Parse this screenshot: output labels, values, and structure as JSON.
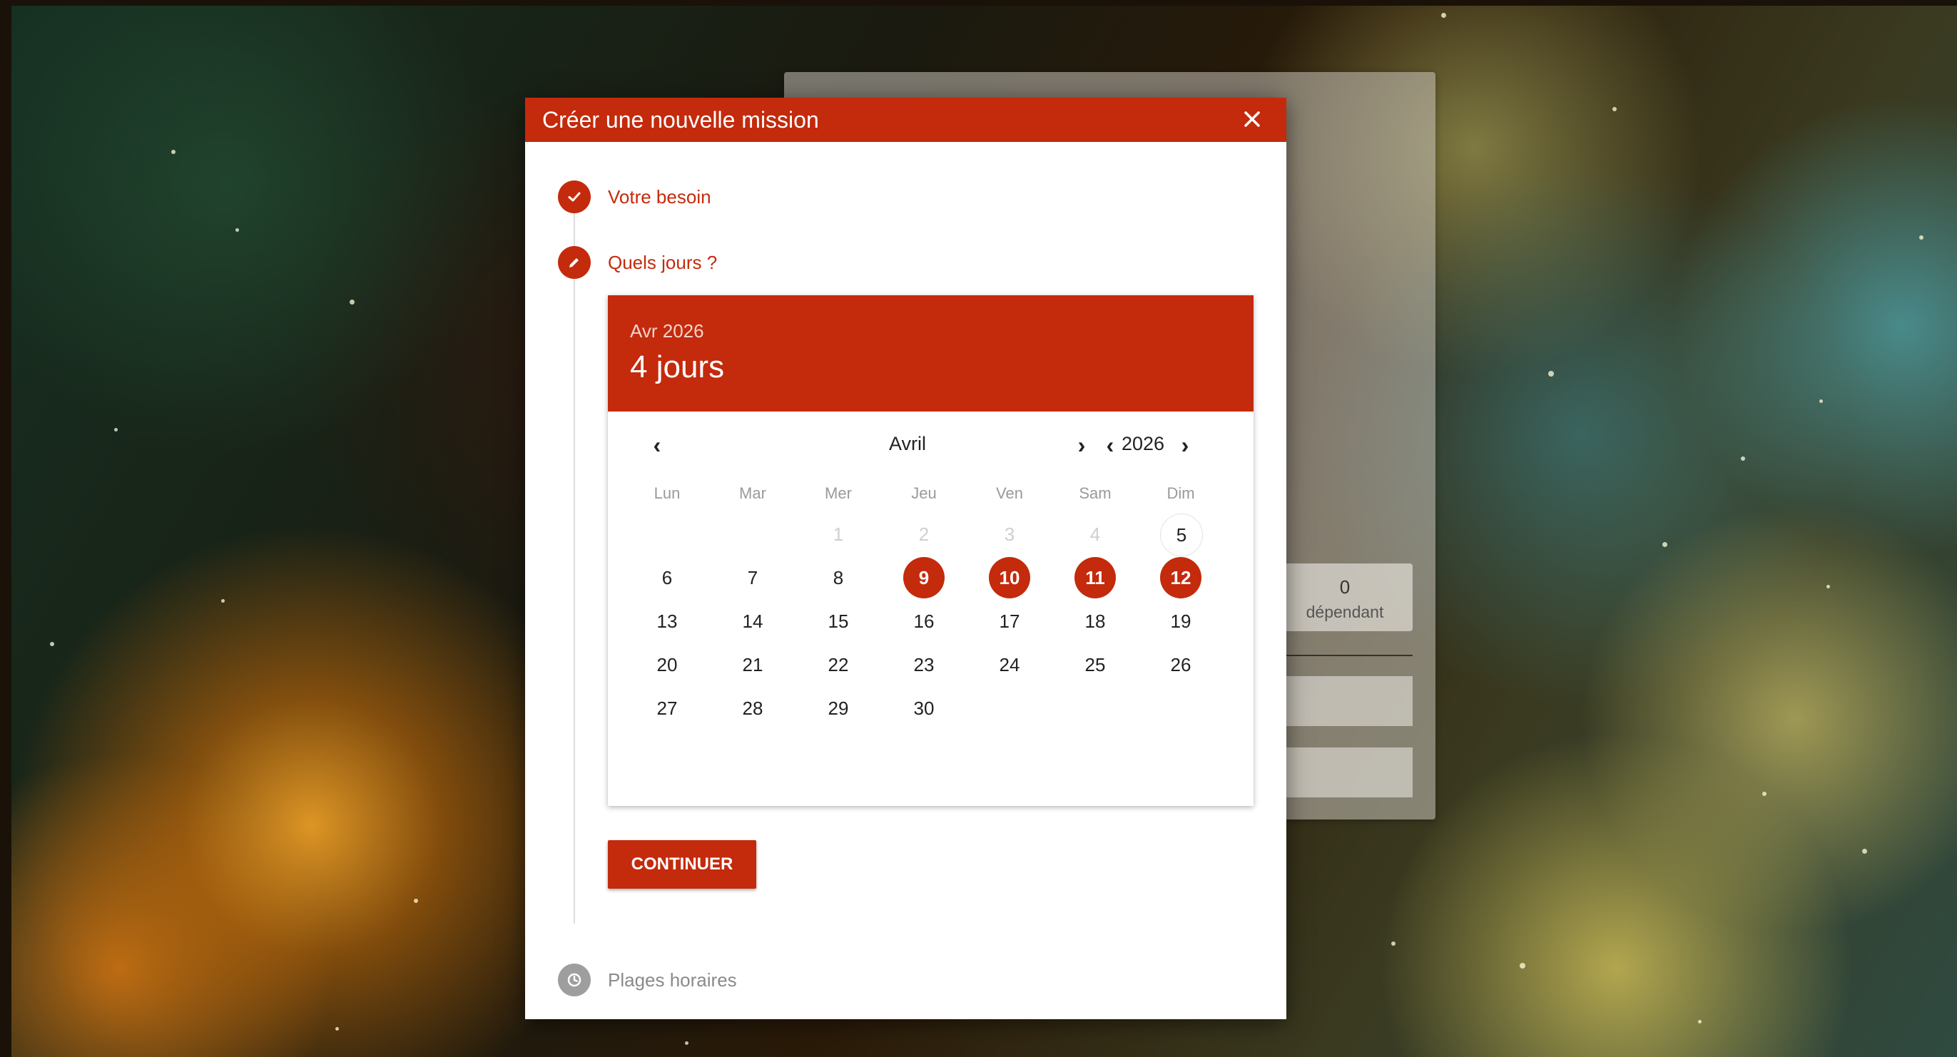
{
  "modal": {
    "title": "Créer une nouvelle mission",
    "close_icon": "close-icon"
  },
  "steps": [
    {
      "label": "Votre besoin",
      "icon": "check-icon",
      "state": "done"
    },
    {
      "label": "Quels jours ?",
      "icon": "pencil-icon",
      "state": "active"
    },
    {
      "label": "Plages horaires",
      "icon": "clock-icon",
      "state": "pending"
    }
  ],
  "calendar": {
    "header_subtitle": "Avr 2026",
    "header_title": "4 jours",
    "month": "Avril",
    "year": "2026",
    "weekdays": [
      "Lun",
      "Mar",
      "Mer",
      "Jeu",
      "Ven",
      "Sam",
      "Dim"
    ],
    "weeks": [
      [
        {
          "d": ""
        },
        {
          "d": ""
        },
        {
          "d": "1",
          "disabled": true
        },
        {
          "d": "2",
          "disabled": true
        },
        {
          "d": "3",
          "disabled": true
        },
        {
          "d": "4",
          "disabled": true
        },
        {
          "d": "5",
          "today": true
        }
      ],
      [
        {
          "d": "6"
        },
        {
          "d": "7"
        },
        {
          "d": "8"
        },
        {
          "d": "9",
          "selected": true
        },
        {
          "d": "10",
          "selected": true
        },
        {
          "d": "11",
          "selected": true
        },
        {
          "d": "12",
          "selected": true
        }
      ],
      [
        {
          "d": "13"
        },
        {
          "d": "14"
        },
        {
          "d": "15"
        },
        {
          "d": "16"
        },
        {
          "d": "17"
        },
        {
          "d": "18"
        },
        {
          "d": "19"
        }
      ],
      [
        {
          "d": "20"
        },
        {
          "d": "21"
        },
        {
          "d": "22"
        },
        {
          "d": "23"
        },
        {
          "d": "24"
        },
        {
          "d": "25"
        },
        {
          "d": "26"
        }
      ],
      [
        {
          "d": "27"
        },
        {
          "d": "28"
        },
        {
          "d": "29"
        },
        {
          "d": "30"
        },
        {
          "d": ""
        },
        {
          "d": ""
        },
        {
          "d": ""
        }
      ]
    ]
  },
  "continue_label": "CONTINUER",
  "background_panel": {
    "stat_value": "0",
    "stat_label": "dépendant"
  },
  "colors": {
    "accent": "#c42a0c",
    "disabled_text": "#cfcfcf",
    "pending_step": "#9e9e9e"
  }
}
